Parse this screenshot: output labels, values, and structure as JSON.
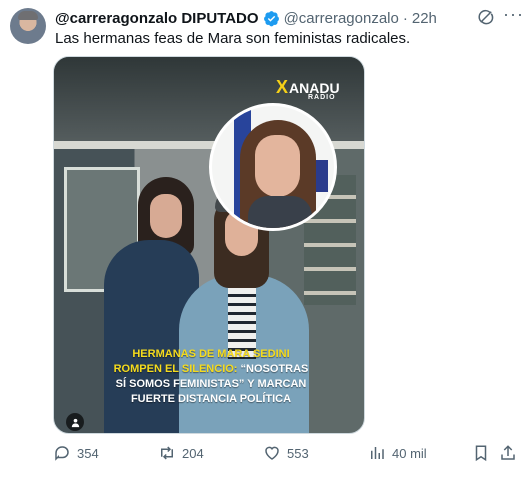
{
  "post": {
    "display_name": "@carreragonzalo DIPUTADO",
    "handle": "@carreragonzalo",
    "separator": "·",
    "time": "22h",
    "text": "Las hermanas feas de Mara son feministas radicales."
  },
  "media": {
    "logo_main": "ANADU",
    "logo_x": "X",
    "logo_sub": "RADIO",
    "headline": {
      "line1": "HERMANAS DE MARA SEDINI",
      "line2_yellow": "ROMPEN EL SILENCIO:",
      "line2_white": " “NOSOTRAS",
      "line3": "SÍ SOMOS FEMINISTAS” Y MARCAN",
      "line4": "FUERTE DISTANCIA POLÍTICA"
    }
  },
  "actions": {
    "replies": "354",
    "reposts": "204",
    "likes": "553",
    "views": "40 mil"
  },
  "icons": {
    "verified": "verified-badge-icon",
    "grok": "grok-icon",
    "more": "more-icon",
    "reply": "reply-icon",
    "repost": "repost-icon",
    "like": "heart-icon",
    "views": "views-icon",
    "bookmark": "bookmark-icon",
    "share": "share-icon"
  },
  "colors": {
    "text": "#0f1419",
    "secondary": "#536471",
    "verified": "#1d9bf0",
    "highlight": "#f5db1d"
  }
}
